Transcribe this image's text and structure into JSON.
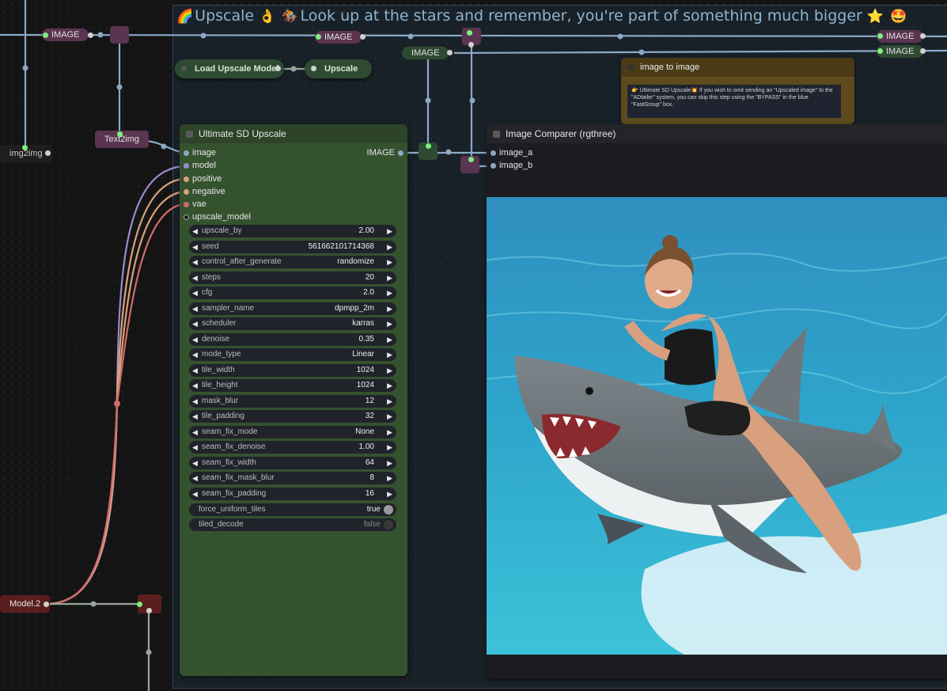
{
  "group": {
    "title": "Upscale",
    "subtitle": "Look up at the stars and remember, you're part of something much bigger",
    "emoji_start": "🌈",
    "emoji_mid1": "👌",
    "emoji_mid2": "🏇",
    "emoji_end1": "⭐",
    "emoji_end2": "🤩"
  },
  "reroutes": {
    "image_label": "IMAGE",
    "text2img_label": "Text2img",
    "img2img_label": "img2img",
    "model2_label": "Model.2"
  },
  "load_upscale_model": {
    "title": "Load Upscale Model"
  },
  "upscale_node": {
    "title": "Upscale"
  },
  "note_node": {
    "title": "image to image",
    "emoji": "👉",
    "text_line1": "Ultimate SD Upscale",
    "text_line1_emoji": "💥",
    "text_body": "If you wish to omit sending an \"Upscaled image\" to the \"ADtailer\" system, you can skip this step using the \"BYPASS\" in the blue \"FastGroup\" box."
  },
  "usd_node": {
    "title": "Ultimate SD Upscale",
    "inputs": [
      "image",
      "model",
      "positive",
      "negative",
      "vae",
      "upscale_model"
    ],
    "output": "IMAGE",
    "widgets": [
      {
        "label": "upscale_by",
        "value": "2.00"
      },
      {
        "label": "seed",
        "value": "561662101714368"
      },
      {
        "label": "control_after_generate",
        "value": "randomize"
      },
      {
        "label": "steps",
        "value": "20"
      },
      {
        "label": "cfg",
        "value": "2.0"
      },
      {
        "label": "sampler_name",
        "value": "dpmpp_2m"
      },
      {
        "label": "scheduler",
        "value": "karras"
      },
      {
        "label": "denoise",
        "value": "0.35"
      },
      {
        "label": "mode_type",
        "value": "Linear"
      },
      {
        "label": "tile_width",
        "value": "1024"
      },
      {
        "label": "tile_height",
        "value": "1024"
      },
      {
        "label": "mask_blur",
        "value": "12"
      },
      {
        "label": "tile_padding",
        "value": "32"
      },
      {
        "label": "seam_fix_mode",
        "value": "None"
      },
      {
        "label": "seam_fix_denoise",
        "value": "1.00"
      },
      {
        "label": "seam_fix_width",
        "value": "64"
      },
      {
        "label": "seam_fix_mask_blur",
        "value": "8"
      },
      {
        "label": "seam_fix_padding",
        "value": "16"
      }
    ],
    "toggles": [
      {
        "label": "force_uniform_tiles",
        "value": "true"
      },
      {
        "label": "tiled_decode",
        "value": "false"
      }
    ]
  },
  "comparer_node": {
    "title": "Image Comparer (rgthree)",
    "inputs": [
      "image_a",
      "image_b"
    ]
  },
  "colors": {
    "usd_body": "#35522f",
    "usd_title": "#2d4428",
    "reroute_purple": "#5a3450",
    "green_node": "#2f4a32",
    "note_body": "#5d4a1e",
    "model2_red": "#5a1e1e"
  }
}
